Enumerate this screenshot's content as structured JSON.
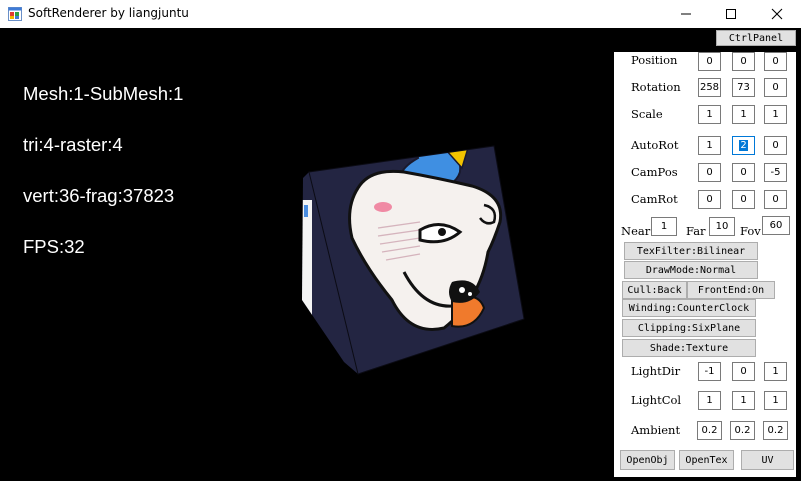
{
  "window": {
    "title": "SoftRenderer by liangjuntu",
    "icon": "app-window-icon",
    "controls": [
      "minimize-icon",
      "maximize-icon",
      "close-icon"
    ]
  },
  "stats": {
    "mesh": "Mesh:1-SubMesh:1",
    "tri": "tri:4-raster:4",
    "vert": "vert:36-frag:37823",
    "fps": "FPS:32"
  },
  "panel": {
    "toggle": "CtrlPanel",
    "position": {
      "label": "Position",
      "x": "0",
      "y": "0",
      "z": "0"
    },
    "rotation": {
      "label": "Rotation",
      "x": "258",
      "y": "73",
      "z": "0"
    },
    "scale": {
      "label": "Scale",
      "x": "1",
      "y": "1",
      "z": "1"
    },
    "autorot": {
      "label": "AutoRot",
      "x": "1",
      "y": "2",
      "z": "0"
    },
    "campos": {
      "label": "CamPos",
      "x": "0",
      "y": "0",
      "z": "-5"
    },
    "camrot": {
      "label": "CamRot",
      "x": "0",
      "y": "0",
      "z": "0"
    },
    "near": {
      "label": "Near",
      "value": "1"
    },
    "far": {
      "label": "Far",
      "value": "10"
    },
    "fov": {
      "label": "Fov",
      "value": "60"
    },
    "texfilter": "TexFilter:Bilinear",
    "drawmode": "DrawMode:Normal",
    "cull": "Cull:Back",
    "frontend": "FrontEnd:On",
    "winding": "Winding:CounterClock",
    "clipping": "Clipping:SixPlane",
    "shade": "Shade:Texture",
    "lightdir": {
      "label": "LightDir",
      "x": "-1",
      "y": "0",
      "z": "1"
    },
    "lightcol": {
      "label": "LightCol",
      "x": "1",
      "y": "1",
      "z": "1"
    },
    "ambient": {
      "label": "Ambient",
      "x": "0.2",
      "y": "0.2",
      "z": "0.2"
    },
    "openobj": "OpenObj",
    "opentex": "OpenTex",
    "uv": "UV"
  },
  "colors": {
    "viewport_bg": "#000000",
    "cube_face_bg": "#232542",
    "button_bg": "#e1e1e1",
    "selection": "#0078d7"
  }
}
